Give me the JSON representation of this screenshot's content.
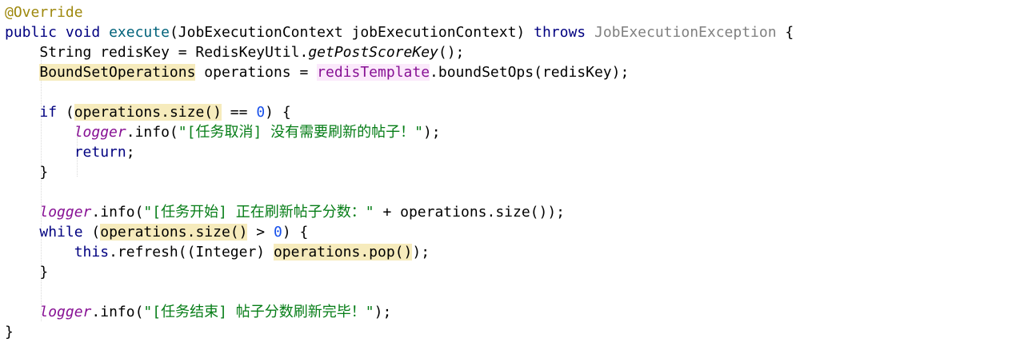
{
  "code_lines": [
    "@Override",
    "public void execute(JobExecutionContext jobExecutionContext) throws JobExecutionException {",
    "    String redisKey = RedisKeyUtil.getPostScoreKey();",
    "    BoundSetOperations operations = redisTemplate.boundSetOps(redisKey);",
    "",
    "    if (operations.size() == 0) {",
    "        logger.info(\"[任务取消] 没有需要刷新的帖子！\");",
    "        return;",
    "    }",
    "",
    "    logger.info(\"[任务开始] 正在刷新帖子分数：\" + operations.size());",
    "    while (operations.size() > 0) {",
    "        this.refresh((Integer) operations.pop());",
    "    }",
    "",
    "    logger.info(\"[任务结束] 帖子分数刷新完毕！\");",
    "}"
  ],
  "tokens": {
    "annotation": "@Override",
    "public": "public",
    "void": "void",
    "execute": "execute",
    "param_decl": "(JobExecutionContext jobExecutionContext)",
    "throws": "throws",
    "exception": "JobExecutionException",
    "brace_open": "{",
    "string_kw": "String redisKey = RedisKeyUtil.",
    "get_post_score_key": "getPostScoreKey",
    "call_end": "();",
    "bound_set_ops_type": "BoundSetOperations",
    "ops_assign": " operations = ",
    "redis_template": "redisTemplate",
    "bound_set_ops_call": ".boundSetOps(redisKey);",
    "if": "if",
    "paren_open": "(",
    "operations_size": "operations.size()",
    "eq": " == ",
    "zero": "0",
    "paren_close_brace": ") {",
    "logger": "logger",
    "info_open": ".info(",
    "str_cancel": "\"[任务取消] 没有需要刷新的帖子！\"",
    "close_stmt": ");",
    "return": "return",
    "semicolon": ";",
    "brace_close": "}",
    "str_start": "\"[任务开始] 正在刷新帖子分数：\"",
    "plus_ops_size": " + operations.size());",
    "while": "while",
    "gt": " > ",
    "this": "this",
    "refresh_call": ".refresh((Integer) ",
    "operations_pop": "operations.pop()",
    "str_end": "\"[任务结束] 帖子分数刷新完毕！\""
  }
}
